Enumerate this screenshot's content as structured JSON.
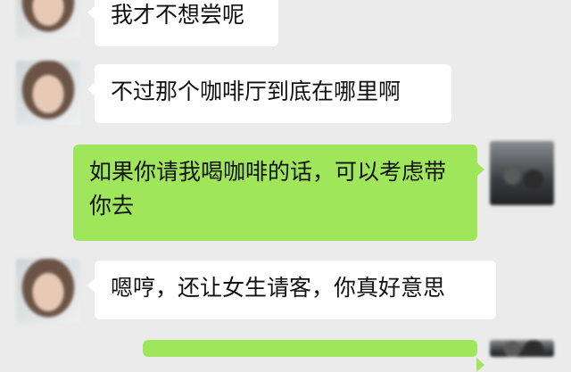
{
  "chat": {
    "messages": [
      {
        "sender": "her",
        "text": "我才不想尝呢"
      },
      {
        "sender": "her",
        "text": "不过那个咖啡厅到底在哪里啊"
      },
      {
        "sender": "me",
        "text": "如果你请我喝咖啡的话，可以考虑带你去"
      },
      {
        "sender": "her",
        "text": "嗯哼，还让女生请客，你真好意思"
      },
      {
        "sender": "me",
        "text": ""
      }
    ]
  },
  "colors": {
    "background": "#ebebeb",
    "incoming_bubble": "#ffffff",
    "outgoing_bubble": "#9fe65a"
  }
}
